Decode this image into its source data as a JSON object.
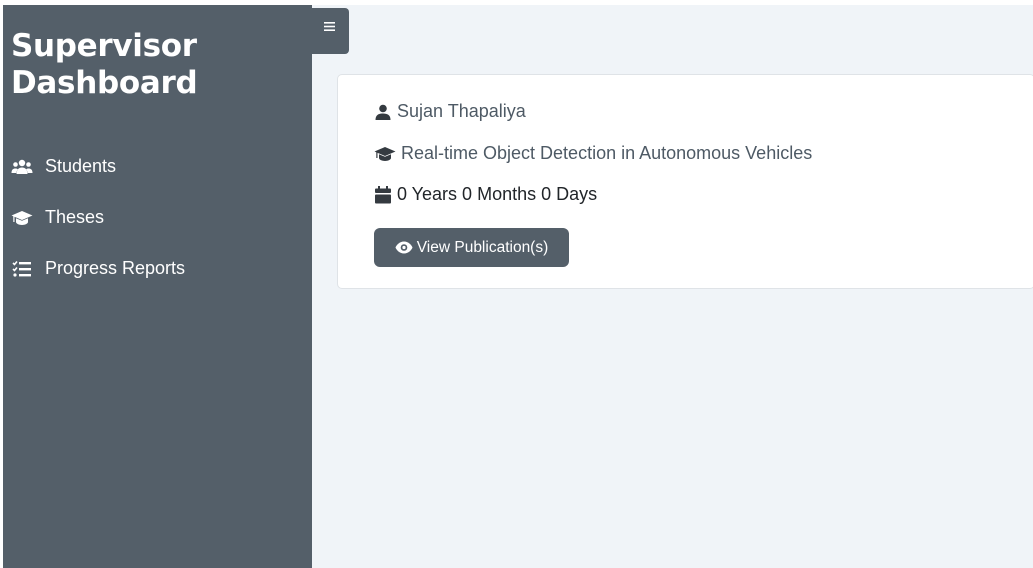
{
  "sidebar": {
    "brand": "Supervisor Dashboard",
    "items": [
      {
        "label": "Students",
        "icon": "users-icon"
      },
      {
        "label": "Theses",
        "icon": "graduation-cap-icon"
      },
      {
        "label": "Progress Reports",
        "icon": "tasks-list-icon"
      }
    ],
    "toggle_icon": "≡"
  },
  "card": {
    "student_name": "Sujan Thapaliya",
    "thesis_title": "Real-time Object Detection in Autonomous Vehicles",
    "duration": "0 Years 0 Months 0 Days",
    "button_label": "View Publication(s)"
  },
  "colors": {
    "sidebar_bg": "#545f69",
    "main_bg": "#f0f4f8",
    "card_bg": "#ffffff",
    "text_muted": "#4e5a65"
  }
}
